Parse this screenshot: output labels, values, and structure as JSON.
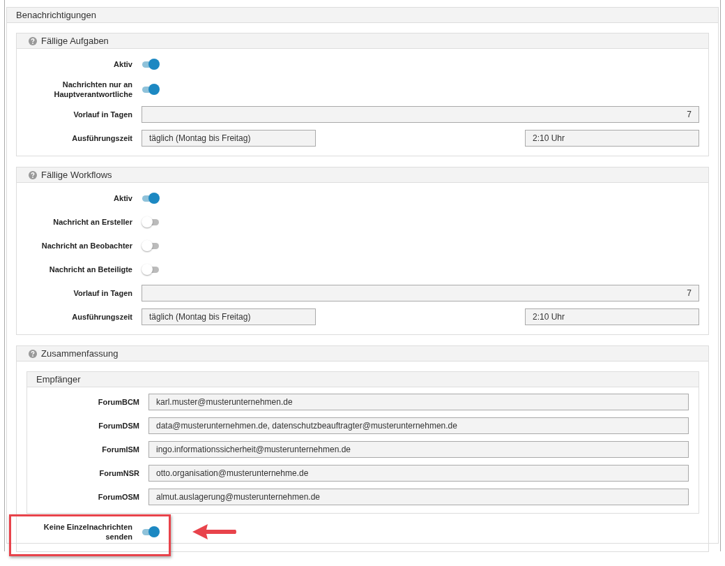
{
  "panel": {
    "title": "Benachrichtigungen"
  },
  "sections": [
    {
      "title": "Fällige Aufgaben",
      "rows": [
        {
          "kind": "toggle",
          "label": "Aktiv",
          "on": true
        },
        {
          "kind": "toggle",
          "label": "Nachrichten nur an Hauptverantwortliche",
          "on": true
        },
        {
          "kind": "number",
          "label": "Vorlauf in Tagen",
          "value": "7"
        },
        {
          "kind": "schedule",
          "label": "Ausführungszeit",
          "value": "täglich (Montag bis Freitag)",
          "time": "2:10 Uhr"
        }
      ]
    },
    {
      "title": "Fällige Workflows",
      "rows": [
        {
          "kind": "toggle",
          "label": "Aktiv",
          "on": true
        },
        {
          "kind": "toggle",
          "label": "Nachricht an Ersteller",
          "on": false
        },
        {
          "kind": "toggle",
          "label": "Nachricht an Beobachter",
          "on": false
        },
        {
          "kind": "toggle",
          "label": "Nachricht an Beteiligte",
          "on": false
        },
        {
          "kind": "number",
          "label": "Vorlauf in Tagen",
          "value": "7"
        },
        {
          "kind": "schedule",
          "label": "Ausführungszeit",
          "value": "täglich (Montag bis Freitag)",
          "time": "2:10 Uhr"
        }
      ]
    },
    {
      "title": "Zusammenfassung",
      "recipients": {
        "title": "Empfänger",
        "rows": [
          {
            "label": "ForumBCM",
            "value": "karl.muster@musterunternehmen.de"
          },
          {
            "label": "ForumDSM",
            "value": "data@musterunternehmen.de, datenschutzbeauftragter@musterunternehmen.de"
          },
          {
            "label": "ForumISM",
            "value": "ingo.informationssicherheit@musterunternehmen.de"
          },
          {
            "label": "ForumNSR",
            "value": "otto.organisation@musterunternehme.de"
          },
          {
            "label": "ForumOSM",
            "value": "almut.auslagerung@musterunternehmen.de"
          }
        ]
      },
      "rows": [
        {
          "kind": "toggle",
          "label": "Keine Einzelnachrichten senden",
          "on": true,
          "highlighted": true
        }
      ]
    }
  ]
}
